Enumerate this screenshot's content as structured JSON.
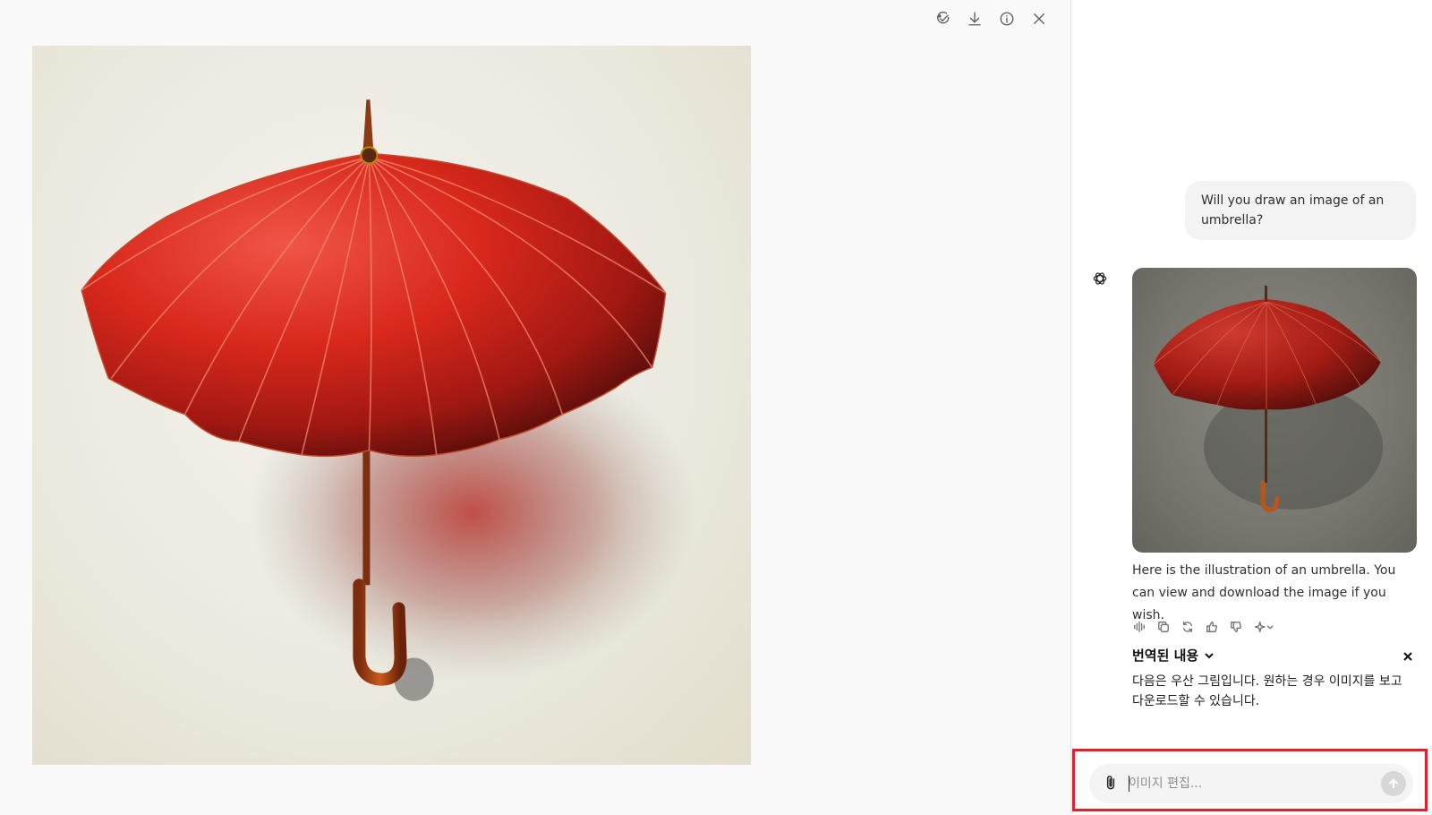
{
  "viewer": {
    "toolbar": [
      {
        "name": "edit-image-icon",
        "label": "Edit"
      },
      {
        "name": "download-icon",
        "label": "Download"
      },
      {
        "name": "info-icon",
        "label": "Info"
      },
      {
        "name": "close-icon",
        "label": "Close"
      }
    ],
    "image": {
      "subject": "red umbrella",
      "background": "#ecebe2",
      "accent": "#d42a1e"
    }
  },
  "chat": {
    "user_message": "Will you draw an image of an umbrella?",
    "assistant": {
      "logo_icon": "openai-logo-icon",
      "image_background": "#77776f",
      "reply": "Here is the illustration of an umbrella. You can view and download the image if you wish.",
      "actions": [
        "read-aloud-icon",
        "copy-icon",
        "regenerate-icon",
        "thumbs-up-icon",
        "thumbs-down-icon",
        "sparkle-model-icon"
      ]
    },
    "translation": {
      "title": "번역된 내용",
      "body": "다음은 우산 그림입니다. 원하는 경우 이미지를 보고 다운로드할 수 있습니다."
    },
    "composer": {
      "placeholder": "이미지 편집...",
      "value": "",
      "highlight_color": "#e0202a"
    }
  }
}
